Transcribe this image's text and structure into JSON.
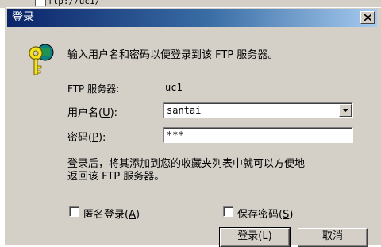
{
  "background": {
    "left_text": "",
    "address_text": "ftp://uc1/"
  },
  "dialog": {
    "title": "登录",
    "intro": "输入用户名和密码以便登录到该 FTP 服务器。",
    "server_label": "FTP 服务器:",
    "server_value": "uc1",
    "username_label": "用户名",
    "username_key": "U",
    "username_value": "santai",
    "password_label": "密码",
    "password_key": "P",
    "password_value": "***",
    "note_line1": "登录后，将其添加到您的收藏夹列表中就可以方便地",
    "note_line2": "返回该 FTP 服务器。",
    "anonymous_label": "匿名登录",
    "anonymous_key": "A",
    "save_password_label": "保存密码",
    "save_password_key": "S",
    "login_button": "登录(L)",
    "cancel_button": "取消"
  },
  "colors": {
    "title_start": "#0a246a",
    "title_end": "#a6caf0",
    "face": "#d4d0c8"
  }
}
